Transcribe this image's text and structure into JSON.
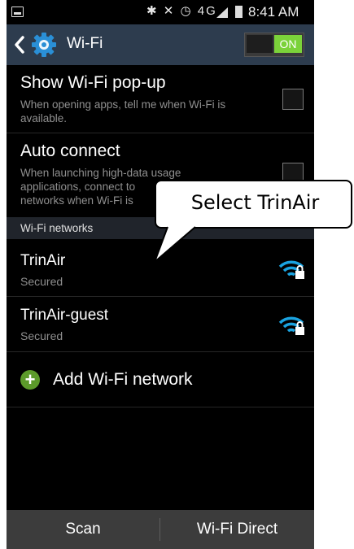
{
  "status_bar": {
    "time": "8:41 AM",
    "icons_text": "✱ ✕ ◷ 4G"
  },
  "action_bar": {
    "title": "Wi-Fi",
    "toggle_label": "ON"
  },
  "settings": [
    {
      "title": "Show Wi-Fi pop-up",
      "description": "When opening apps, tell me when Wi-Fi is available."
    },
    {
      "title": "Auto connect",
      "description_line1": "When launching high-data usage",
      "description_line2": "applications, connect to",
      "description_line3": "networks when Wi-Fi is"
    }
  ],
  "section_header": "Wi-Fi networks",
  "networks": [
    {
      "ssid": "TrinAir",
      "status": "Secured"
    },
    {
      "ssid": "TrinAir-guest",
      "status": "Secured"
    }
  ],
  "add_network_label": "Add Wi-Fi network",
  "bottom_bar": {
    "scan_label": "Scan",
    "direct_label": "Wi-Fi Direct"
  },
  "callout": {
    "text": "Select TrinAir"
  },
  "colors": {
    "toggle_on": "#7bd23a",
    "action_bar": "#2d3c4e",
    "wifi_icon": "#1aa3e0"
  }
}
